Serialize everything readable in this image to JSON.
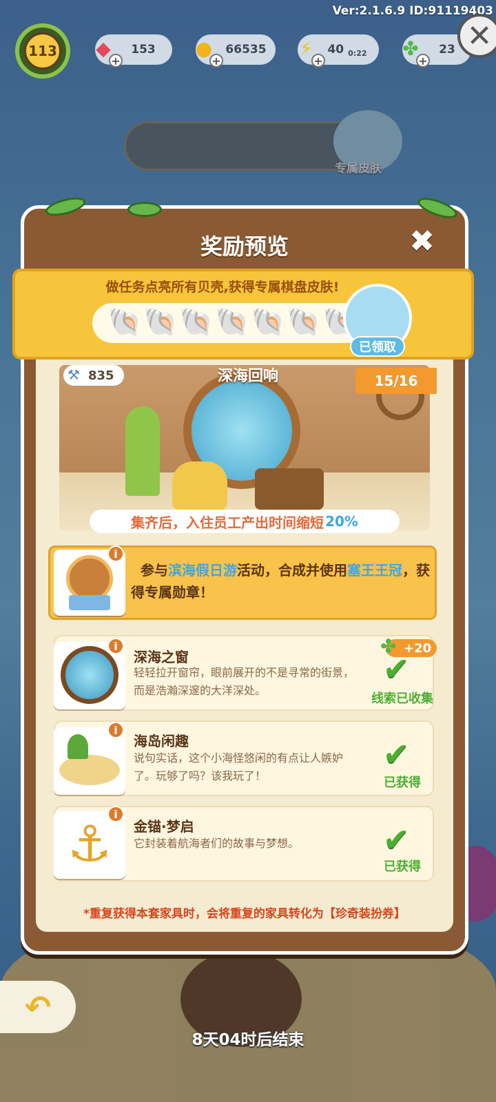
{
  "version_text": "Ver:2.1.6.9 ID:91119403",
  "player": {
    "level": "113"
  },
  "resources": [
    {
      "name": "gems",
      "value": "153",
      "icon": "gem-icon",
      "color": "#e04a5a"
    },
    {
      "name": "coins",
      "value": "66535",
      "icon": "coin-icon",
      "color": "#f2b31c"
    },
    {
      "name": "energy",
      "value": "40",
      "sub": "0:22",
      "icon": "lightning-icon",
      "color": "#f2c21c"
    },
    {
      "name": "clover",
      "value": "23",
      "icon": "clover-icon",
      "color": "#52b848"
    }
  ],
  "background": {
    "skin_label": "专属皮肤"
  },
  "modal": {
    "title": "奖励预览",
    "banner_text": "做任务点亮所有贝壳,获得专属棋盘皮肤!",
    "shell_count": 7,
    "claimed_label": "已领取",
    "room": {
      "name": "深海回响",
      "coins": "835",
      "progress": "15/16",
      "bonus_text": "集齐后，入住员工产出时间缩短",
      "bonus_value": "20%"
    },
    "medal": {
      "part1": "参与",
      "link1": "滨海假日游",
      "part2": "活动，合成并使用",
      "link2": "塞王王冠",
      "part3": "，获得专属勋章！"
    },
    "items": [
      {
        "name": "深海之窗",
        "desc": "轻轻拉开窗帘，眼前展开的不是寻常的街景，而是浩瀚深邃的大洋深处。",
        "status": "线索已收集",
        "bonus": "+20"
      },
      {
        "name": "海岛闲趣",
        "desc": "说句实话，这个小海怪悠闲的有点让人嫉妒了。玩够了吗？该我玩了！",
        "status": "已获得"
      },
      {
        "name": "金锚·梦启",
        "desc": "它封装着航海者们的故事与梦想。",
        "status": "已获得"
      }
    ],
    "footnote": "*重复获得本套家具时，会将重复的家具转化为【珍奇装扮券】"
  },
  "countdown": "8天04时后结束"
}
